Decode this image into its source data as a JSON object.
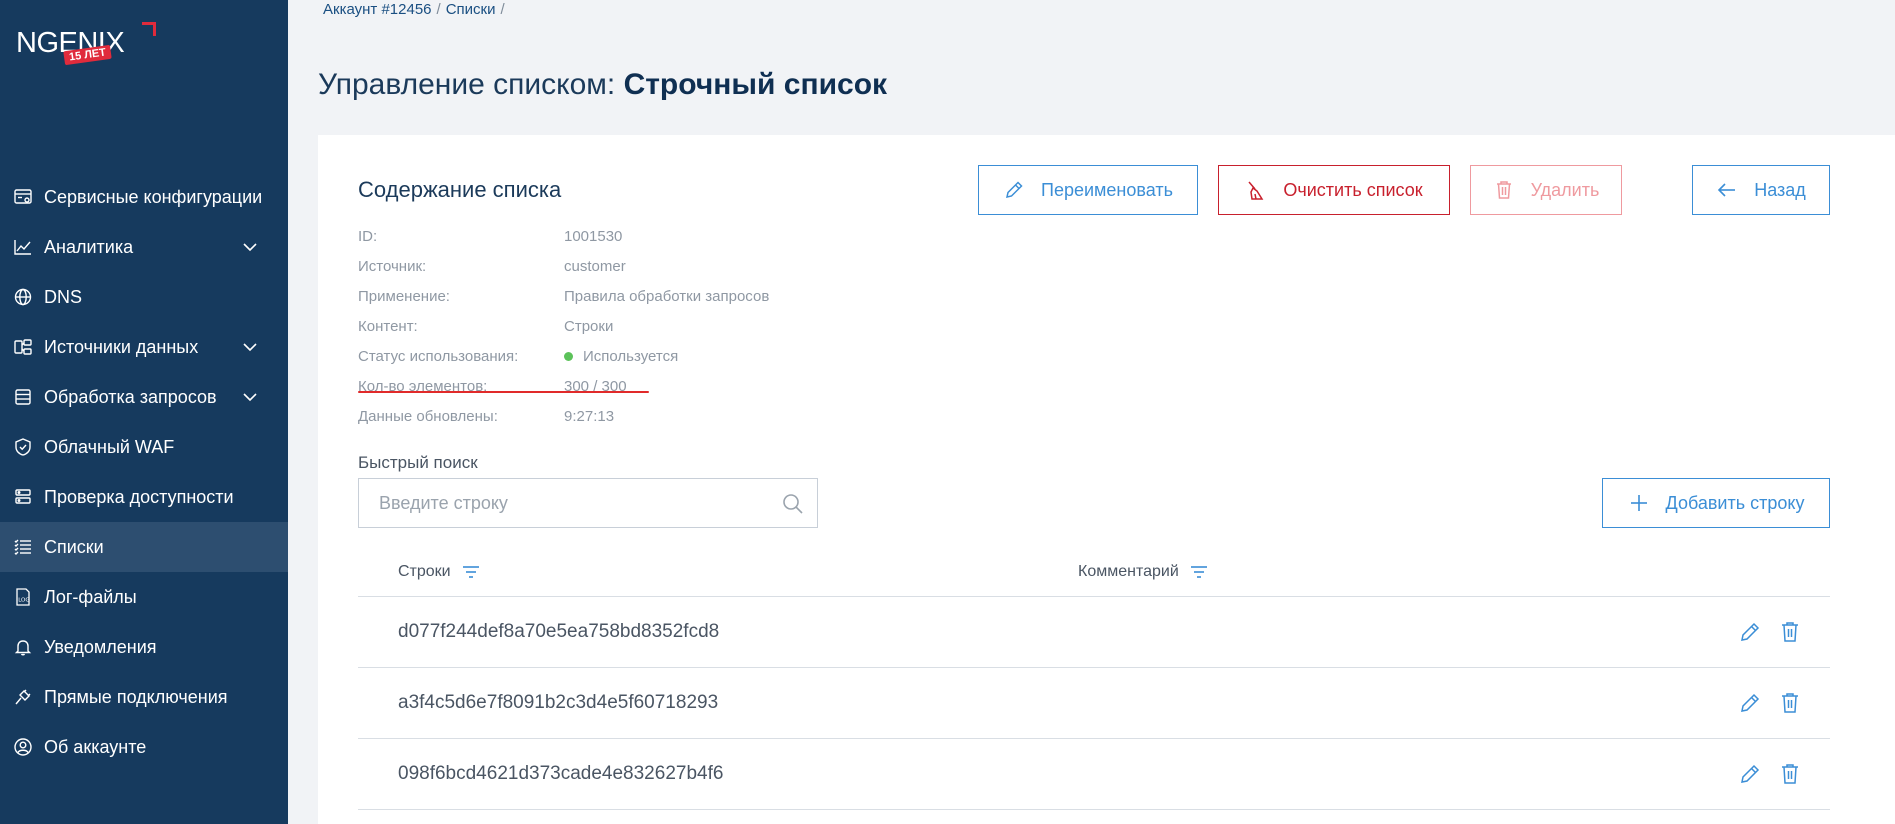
{
  "brand": {
    "name": "NGENIX",
    "badge": "15 ЛЕТ",
    "accent": "#e02b3c"
  },
  "sidebar": {
    "items": [
      {
        "label": "Сервисные конфигурации",
        "icon": "config-icon",
        "chevron": false,
        "active": false
      },
      {
        "label": "Аналитика",
        "icon": "chart-line-icon",
        "chevron": true,
        "active": false
      },
      {
        "label": "DNS",
        "icon": "globe-icon",
        "chevron": false,
        "active": false
      },
      {
        "label": "Источники данных",
        "icon": "data-source-icon",
        "chevron": true,
        "active": false
      },
      {
        "label": "Обработка запросов",
        "icon": "request-processing-icon",
        "chevron": true,
        "active": false
      },
      {
        "label": "Облачный WAF",
        "icon": "shield-icon",
        "chevron": false,
        "active": false
      },
      {
        "label": "Проверка доступности",
        "icon": "server-check-icon",
        "chevron": false,
        "active": false
      },
      {
        "label": "Списки",
        "icon": "list-icon",
        "chevron": false,
        "active": true
      },
      {
        "label": "Лог-файлы",
        "icon": "log-file-icon",
        "chevron": false,
        "active": false
      },
      {
        "label": "Уведомления",
        "icon": "bell-icon",
        "chevron": false,
        "active": false
      },
      {
        "label": "Прямые подключения",
        "icon": "plug-icon",
        "chevron": false,
        "active": false
      },
      {
        "label": "Об аккаунте",
        "icon": "user-icon",
        "chevron": false,
        "active": false
      }
    ]
  },
  "breadcrumb": {
    "account": "Аккаунт #12456",
    "lists": "Списки",
    "sep": "/"
  },
  "page": {
    "title_prefix": "Управление списком:",
    "title_name": "Строчный список"
  },
  "content": {
    "section_title": "Содержание списка",
    "buttons": {
      "rename": "Переименовать",
      "clear": "Очистить список",
      "delete": "Удалить",
      "back": "Назад",
      "add": "Добавить строку"
    },
    "info": [
      {
        "label": "ID:",
        "value": "1001530"
      },
      {
        "label": "Источник:",
        "value": "customer"
      },
      {
        "label": "Применение:",
        "value": "Правила обработки запросов"
      },
      {
        "label": "Контент:",
        "value": "Строки"
      },
      {
        "label": "Статус использования:",
        "value": "Используется"
      },
      {
        "label": "Кол-во элементов:",
        "value": "300 / 300"
      },
      {
        "label": "Данные обновлены:",
        "value": "9:27:13"
      }
    ],
    "status_color": "#5cc25a",
    "search": {
      "label": "Быстрый поиск",
      "placeholder": "Введите строку"
    },
    "table": {
      "columns": [
        "Строки",
        "Комментарий"
      ],
      "rows": [
        {
          "value": "d077f244def8a70e5ea758bd8352fcd8",
          "comment": ""
        },
        {
          "value": "a3f4c5d6e7f8091b2c3d4e5f60718293",
          "comment": ""
        },
        {
          "value": "098f6bcd4621d373cade4e832627b4f6",
          "comment": ""
        }
      ]
    }
  },
  "colors": {
    "sidebar_bg": "#163a5e",
    "primary": "#3b8ed6",
    "danger": "#c8202d"
  }
}
